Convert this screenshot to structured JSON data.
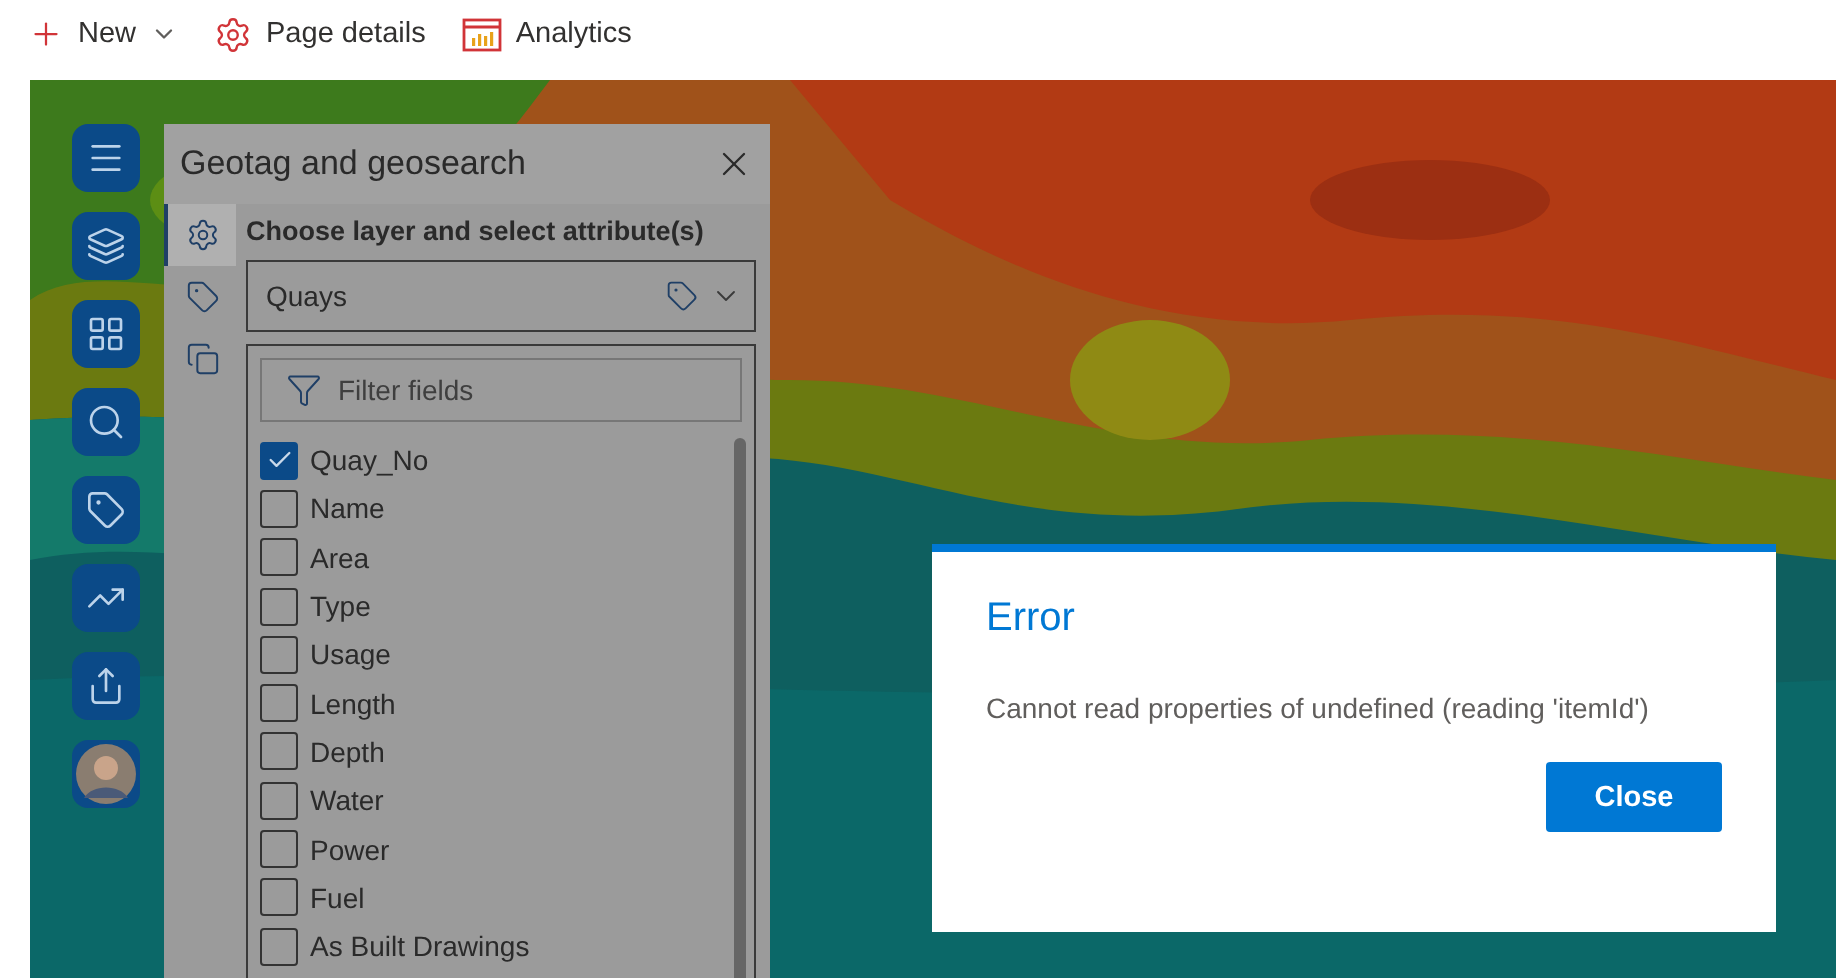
{
  "toolbar": [
    {
      "kind": "new",
      "label": "New",
      "has_menu": true
    },
    {
      "kind": "page",
      "label": "Page details",
      "has_menu": false
    },
    {
      "kind": "analytics",
      "label": "Analytics",
      "has_menu": false
    }
  ],
  "panel": {
    "title": "Geotag and geosearch",
    "side_tabs": [
      {
        "selected": true
      },
      {
        "selected": false
      },
      {
        "selected": false
      }
    ],
    "heading": "Choose layer and select attribute(s)",
    "layer": "Quays",
    "filter": {
      "placeholder": "Filter fields"
    },
    "fields": [
      {
        "label": "Quay_No",
        "checked": true
      },
      {
        "label": "Name",
        "checked": false
      },
      {
        "label": "Area",
        "checked": false
      },
      {
        "label": "Type",
        "checked": false
      },
      {
        "label": "Usage",
        "checked": false
      },
      {
        "label": "Length",
        "checked": false
      },
      {
        "label": "Depth",
        "checked": false
      },
      {
        "label": "Water",
        "checked": false
      },
      {
        "label": "Power",
        "checked": false
      },
      {
        "label": "Fuel",
        "checked": false
      },
      {
        "label": "As Built Drawings",
        "checked": false
      }
    ]
  },
  "dialog": {
    "title": "Error",
    "message": "Cannot read properties of undefined (reading 'itemId')",
    "button": "Close"
  }
}
